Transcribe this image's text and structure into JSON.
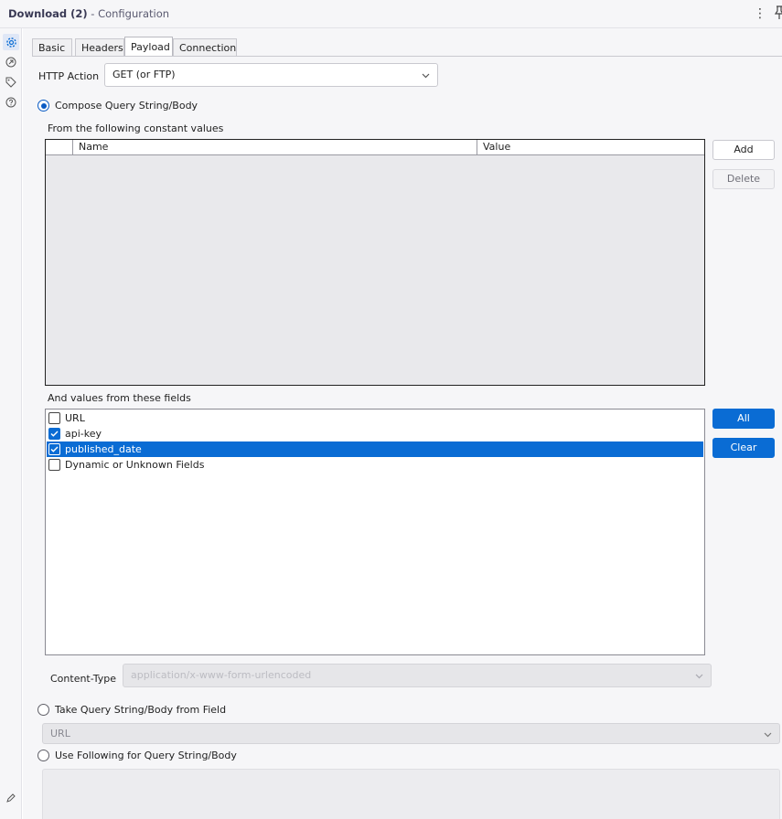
{
  "window": {
    "title_main": "Download (2)",
    "title_sub": " - Configuration",
    "kebab_glyph": "⋮"
  },
  "tabs": [
    {
      "label": "Basic"
    },
    {
      "label": "Headers"
    },
    {
      "label": "Payload"
    },
    {
      "label": "Connection"
    }
  ],
  "http_action": {
    "label": "HTTP Action",
    "value": "GET (or FTP)"
  },
  "compose": {
    "label": "Compose Query String/Body",
    "constants_label": "From the following constant values",
    "columns": [
      "Name",
      "Value"
    ],
    "add_label": "Add",
    "delete_label": "Delete",
    "fields_label": "And values from these fields",
    "fields": [
      {
        "name": "URL",
        "checked": false
      },
      {
        "name": "api-key",
        "checked": true
      },
      {
        "name": "published_date",
        "checked": true,
        "selected": true
      },
      {
        "name": "Dynamic or Unknown Fields",
        "checked": false
      }
    ],
    "all_label": "All",
    "clear_label": "Clear",
    "content_type_label": "Content-Type",
    "content_type_value": "application/x-www-form-urlencoded"
  },
  "take_from_field": {
    "label": "Take Query String/Body from Field",
    "value": "URL"
  },
  "use_following": {
    "label": "Use Following for Query String/Body"
  },
  "colors": {
    "accent": "#0a6cd4",
    "panel": "#f6f6f8"
  }
}
